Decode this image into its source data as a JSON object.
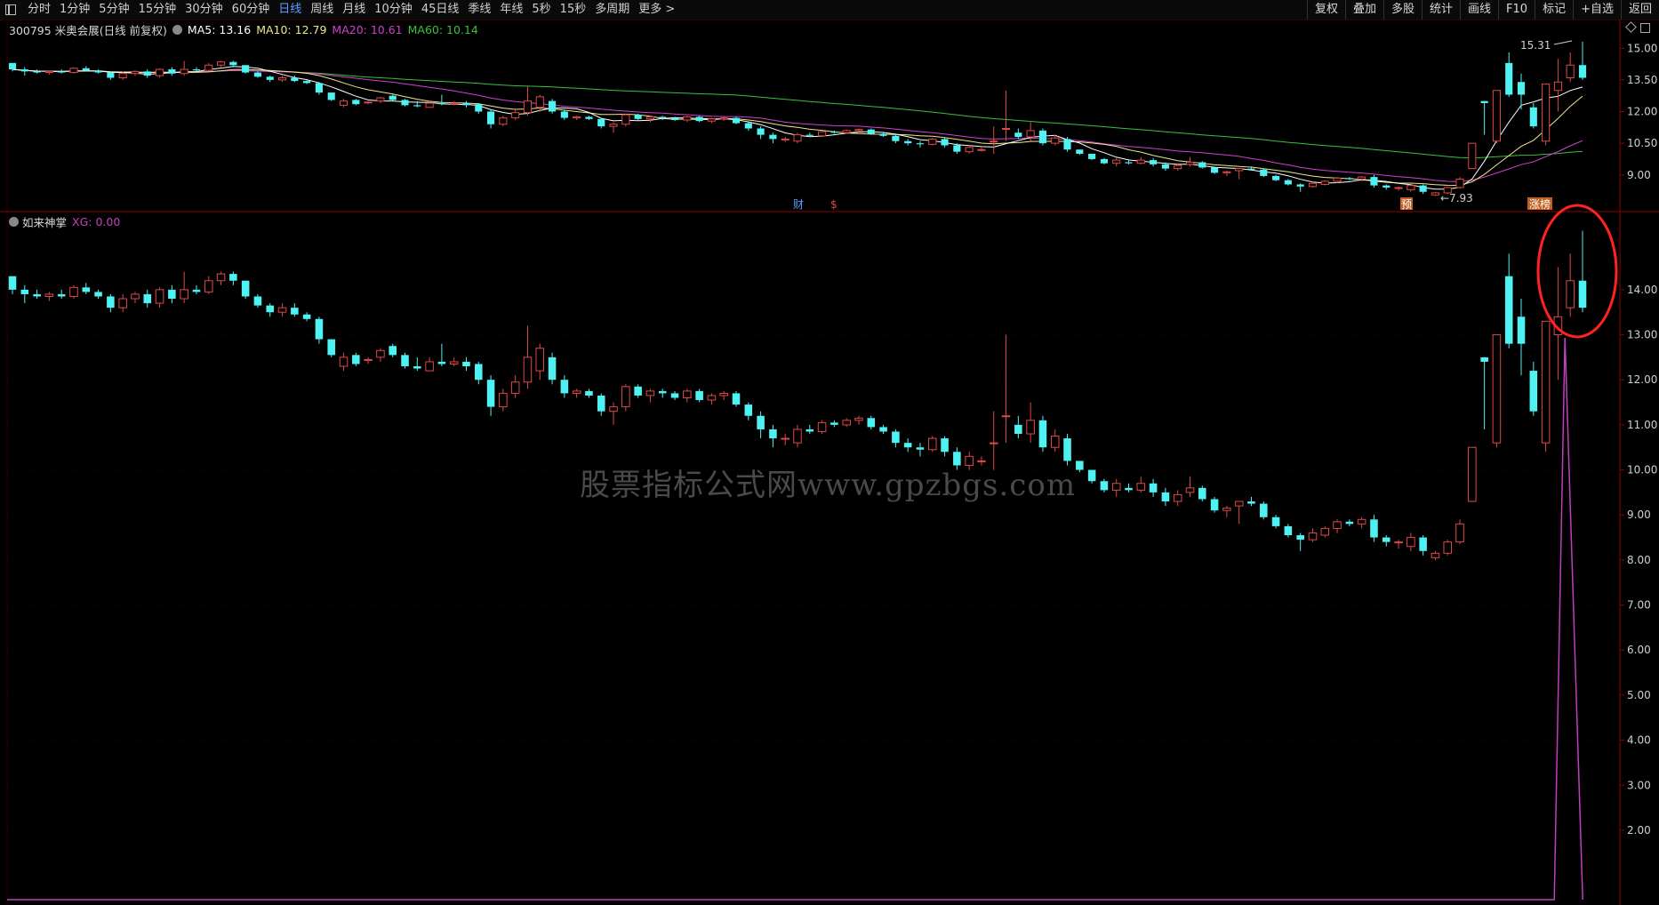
{
  "toolbar": {
    "periods": [
      "分时",
      "1分钟",
      "5分钟",
      "15分钟",
      "30分钟",
      "60分钟",
      "日线",
      "周线",
      "月线",
      "10分钟",
      "45日线",
      "季线",
      "年线",
      "5秒",
      "15秒",
      "多周期",
      "更多 >"
    ],
    "active_period": "日线",
    "right_buttons": [
      "复权",
      "叠加",
      "多股",
      "统计",
      "画线",
      "F10",
      "标记",
      "+自选",
      "返回"
    ]
  },
  "main_info": {
    "stock": "300795 米奥会展(日线 前复权)",
    "ma5": "MA5: 13.16",
    "ma10": "MA10: 12.79",
    "ma20": "MA20: 10.61",
    "ma60": "MA60: 10.14"
  },
  "indicator_info": {
    "name": "如来神掌",
    "xg": "XG: 0.00"
  },
  "axis_main": [
    "15.00",
    "13.50",
    "12.00",
    "10.50",
    "9.00"
  ],
  "axis_ind": [
    "14.00",
    "13.00",
    "12.00",
    "11.00",
    "10.00",
    "9.00",
    "8.00",
    "7.00",
    "6.00",
    "5.00",
    "4.00",
    "3.00",
    "2.00"
  ],
  "annotations": {
    "high": "15.31",
    "low": "7.93",
    "mark_cai": "财",
    "mark_dollar": "$",
    "mark_yu": "预",
    "mark_zhangbang": "涨榜"
  },
  "watermark": "股票指标公式网www.gpzbgs.com",
  "colors": {
    "up": "#e04848",
    "down": "#4ef2f2",
    "ma5": "#ffffff",
    "ma10": "#f0e68c",
    "ma20": "#d040d0",
    "ma60": "#3cbf3c",
    "xg_line": "#c040c0",
    "frame": "#8b0000",
    "highlight_circle": "#ff2222"
  },
  "chart_data": {
    "type": "candlestick",
    "date_labels": [],
    "ohlc": [
      [
        14.3,
        14.3,
        13.9,
        14.0
      ],
      [
        14.0,
        14.1,
        13.7,
        13.9
      ],
      [
        13.9,
        14.0,
        13.8,
        13.85
      ],
      [
        13.85,
        13.95,
        13.75,
        13.9
      ],
      [
        13.9,
        14.0,
        13.8,
        13.85
      ],
      [
        13.85,
        14.1,
        13.8,
        14.05
      ],
      [
        14.05,
        14.15,
        13.9,
        13.95
      ],
      [
        13.95,
        14.0,
        13.8,
        13.85
      ],
      [
        13.85,
        13.9,
        13.5,
        13.6
      ],
      [
        13.6,
        13.9,
        13.5,
        13.8
      ],
      [
        13.8,
        13.95,
        13.7,
        13.9
      ],
      [
        13.9,
        14.0,
        13.6,
        13.7
      ],
      [
        13.7,
        14.05,
        13.6,
        14.0
      ],
      [
        14.0,
        14.1,
        13.7,
        13.8
      ],
      [
        13.8,
        14.4,
        13.7,
        14.0
      ],
      [
        14.0,
        14.1,
        13.9,
        13.95
      ],
      [
        13.95,
        14.3,
        13.9,
        14.2
      ],
      [
        14.2,
        14.4,
        14.1,
        14.35
      ],
      [
        14.35,
        14.4,
        14.1,
        14.2
      ],
      [
        14.2,
        14.2,
        13.8,
        13.85
      ],
      [
        13.85,
        13.9,
        13.6,
        13.65
      ],
      [
        13.65,
        13.7,
        13.4,
        13.5
      ],
      [
        13.5,
        13.7,
        13.4,
        13.6
      ],
      [
        13.6,
        13.7,
        13.4,
        13.45
      ],
      [
        13.45,
        13.5,
        13.3,
        13.35
      ],
      [
        13.35,
        13.4,
        12.8,
        12.9
      ],
      [
        12.9,
        12.9,
        12.5,
        12.55
      ],
      [
        12.3,
        12.6,
        12.2,
        12.5
      ],
      [
        12.55,
        12.6,
        12.3,
        12.35
      ],
      [
        12.45,
        12.5,
        12.35,
        12.45
      ],
      [
        12.5,
        12.7,
        12.4,
        12.65
      ],
      [
        12.75,
        12.8,
        12.5,
        12.55
      ],
      [
        12.55,
        12.6,
        12.25,
        12.3
      ],
      [
        12.3,
        12.5,
        12.2,
        12.25
      ],
      [
        12.2,
        12.5,
        12.2,
        12.4
      ],
      [
        12.4,
        12.8,
        12.3,
        12.35
      ],
      [
        12.35,
        12.5,
        12.3,
        12.4
      ],
      [
        12.4,
        12.5,
        12.2,
        12.3
      ],
      [
        12.35,
        12.4,
        11.9,
        12.0
      ],
      [
        12.0,
        12.1,
        11.2,
        11.4
      ],
      [
        11.4,
        11.8,
        11.3,
        11.7
      ],
      [
        11.7,
        12.1,
        11.6,
        11.95
      ],
      [
        11.95,
        13.2,
        11.8,
        12.5
      ],
      [
        12.2,
        12.8,
        12.0,
        12.7
      ],
      [
        12.5,
        12.6,
        11.9,
        12.0
      ],
      [
        12.0,
        12.1,
        11.6,
        11.7
      ],
      [
        11.7,
        11.8,
        11.6,
        11.75
      ],
      [
        11.75,
        11.8,
        11.6,
        11.65
      ],
      [
        11.65,
        11.7,
        11.2,
        11.3
      ],
      [
        11.3,
        11.5,
        11.0,
        11.4
      ],
      [
        11.4,
        11.9,
        11.3,
        11.85
      ],
      [
        11.85,
        11.9,
        11.6,
        11.65
      ],
      [
        11.65,
        11.8,
        11.5,
        11.75
      ],
      [
        11.75,
        11.8,
        11.6,
        11.7
      ],
      [
        11.7,
        11.75,
        11.55,
        11.6
      ],
      [
        11.6,
        11.8,
        11.5,
        11.75
      ],
      [
        11.75,
        11.8,
        11.5,
        11.55
      ],
      [
        11.55,
        11.7,
        11.45,
        11.65
      ],
      [
        11.65,
        11.75,
        11.55,
        11.7
      ],
      [
        11.7,
        11.75,
        11.4,
        11.45
      ],
      [
        11.45,
        11.5,
        11.1,
        11.2
      ],
      [
        11.2,
        11.3,
        10.7,
        10.9
      ],
      [
        10.9,
        11.0,
        10.5,
        10.7
      ],
      [
        10.7,
        10.8,
        10.55,
        10.7
      ],
      [
        10.6,
        11.0,
        10.5,
        10.9
      ],
      [
        10.9,
        11.0,
        10.8,
        10.85
      ],
      [
        10.85,
        11.1,
        10.8,
        11.05
      ],
      [
        11.05,
        11.1,
        10.95,
        11.0
      ],
      [
        11.0,
        11.15,
        10.95,
        11.1
      ],
      [
        11.1,
        11.2,
        11.0,
        11.15
      ],
      [
        11.15,
        11.2,
        10.9,
        10.95
      ],
      [
        10.95,
        11.0,
        10.8,
        10.85
      ],
      [
        10.85,
        10.9,
        10.5,
        10.6
      ],
      [
        10.6,
        10.7,
        10.4,
        10.5
      ],
      [
        10.5,
        10.6,
        10.3,
        10.45
      ],
      [
        10.45,
        10.75,
        10.4,
        10.7
      ],
      [
        10.7,
        10.75,
        10.3,
        10.4
      ],
      [
        10.4,
        10.5,
        10.0,
        10.1
      ],
      [
        10.1,
        10.4,
        10.0,
        10.3
      ],
      [
        10.2,
        10.3,
        10.1,
        10.2
      ],
      [
        10.6,
        11.3,
        10.0,
        10.6
      ],
      [
        11.2,
        13.0,
        10.6,
        11.2
      ],
      [
        11.0,
        11.2,
        10.7,
        10.8
      ],
      [
        10.8,
        11.5,
        10.6,
        11.1
      ],
      [
        11.1,
        11.2,
        10.4,
        10.5
      ],
      [
        10.5,
        10.9,
        10.4,
        10.75
      ],
      [
        10.7,
        10.8,
        10.1,
        10.2
      ],
      [
        10.2,
        10.2,
        9.95,
        10.0
      ],
      [
        10.0,
        10.0,
        9.7,
        9.75
      ],
      [
        9.75,
        9.8,
        9.5,
        9.55
      ],
      [
        9.55,
        9.8,
        9.4,
        9.7
      ],
      [
        9.6,
        9.7,
        9.5,
        9.55
      ],
      [
        9.55,
        9.85,
        9.5,
        9.7
      ],
      [
        9.7,
        9.8,
        9.4,
        9.5
      ],
      [
        9.5,
        9.6,
        9.2,
        9.3
      ],
      [
        9.3,
        9.55,
        9.2,
        9.45
      ],
      [
        9.5,
        9.85,
        9.4,
        9.6
      ],
      [
        9.6,
        9.65,
        9.3,
        9.35
      ],
      [
        9.35,
        9.4,
        9.05,
        9.1
      ],
      [
        9.1,
        9.2,
        8.95,
        9.15
      ],
      [
        9.2,
        9.2,
        8.8,
        9.3
      ],
      [
        9.3,
        9.4,
        9.2,
        9.25
      ],
      [
        9.25,
        9.3,
        8.9,
        8.95
      ],
      [
        8.95,
        9.0,
        8.7,
        8.75
      ],
      [
        8.75,
        8.8,
        8.5,
        8.55
      ],
      [
        8.55,
        8.6,
        8.2,
        8.45
      ],
      [
        8.45,
        8.7,
        8.4,
        8.6
      ],
      [
        8.55,
        8.75,
        8.5,
        8.7
      ],
      [
        8.7,
        8.9,
        8.6,
        8.85
      ],
      [
        8.85,
        8.9,
        8.75,
        8.8
      ],
      [
        8.8,
        8.95,
        8.7,
        8.9
      ],
      [
        8.9,
        9.0,
        8.4,
        8.5
      ],
      [
        8.5,
        8.55,
        8.3,
        8.4
      ],
      [
        8.4,
        8.45,
        8.25,
        8.4
      ],
      [
        8.3,
        8.6,
        8.2,
        8.5
      ],
      [
        8.5,
        8.55,
        8.1,
        8.2
      ],
      [
        8.05,
        8.2,
        8.0,
        8.15
      ],
      [
        8.15,
        8.45,
        8.1,
        8.4
      ],
      [
        8.4,
        8.9,
        8.35,
        8.8
      ],
      [
        9.3,
        9.3,
        9.3,
        10.5
      ],
      [
        12.5,
        12.5,
        10.9,
        12.4
      ],
      [
        10.6,
        13.0,
        10.5,
        13.0
      ],
      [
        14.3,
        14.8,
        12.7,
        12.8
      ],
      [
        13.4,
        13.8,
        12.1,
        12.8
      ],
      [
        12.2,
        12.4,
        11.2,
        11.3
      ],
      [
        10.6,
        13.0,
        10.4,
        13.3
      ],
      [
        13.0,
        14.5,
        12.0,
        13.4
      ],
      [
        13.6,
        14.8,
        13.4,
        14.2
      ],
      [
        14.2,
        15.31,
        13.5,
        13.6
      ]
    ]
  }
}
